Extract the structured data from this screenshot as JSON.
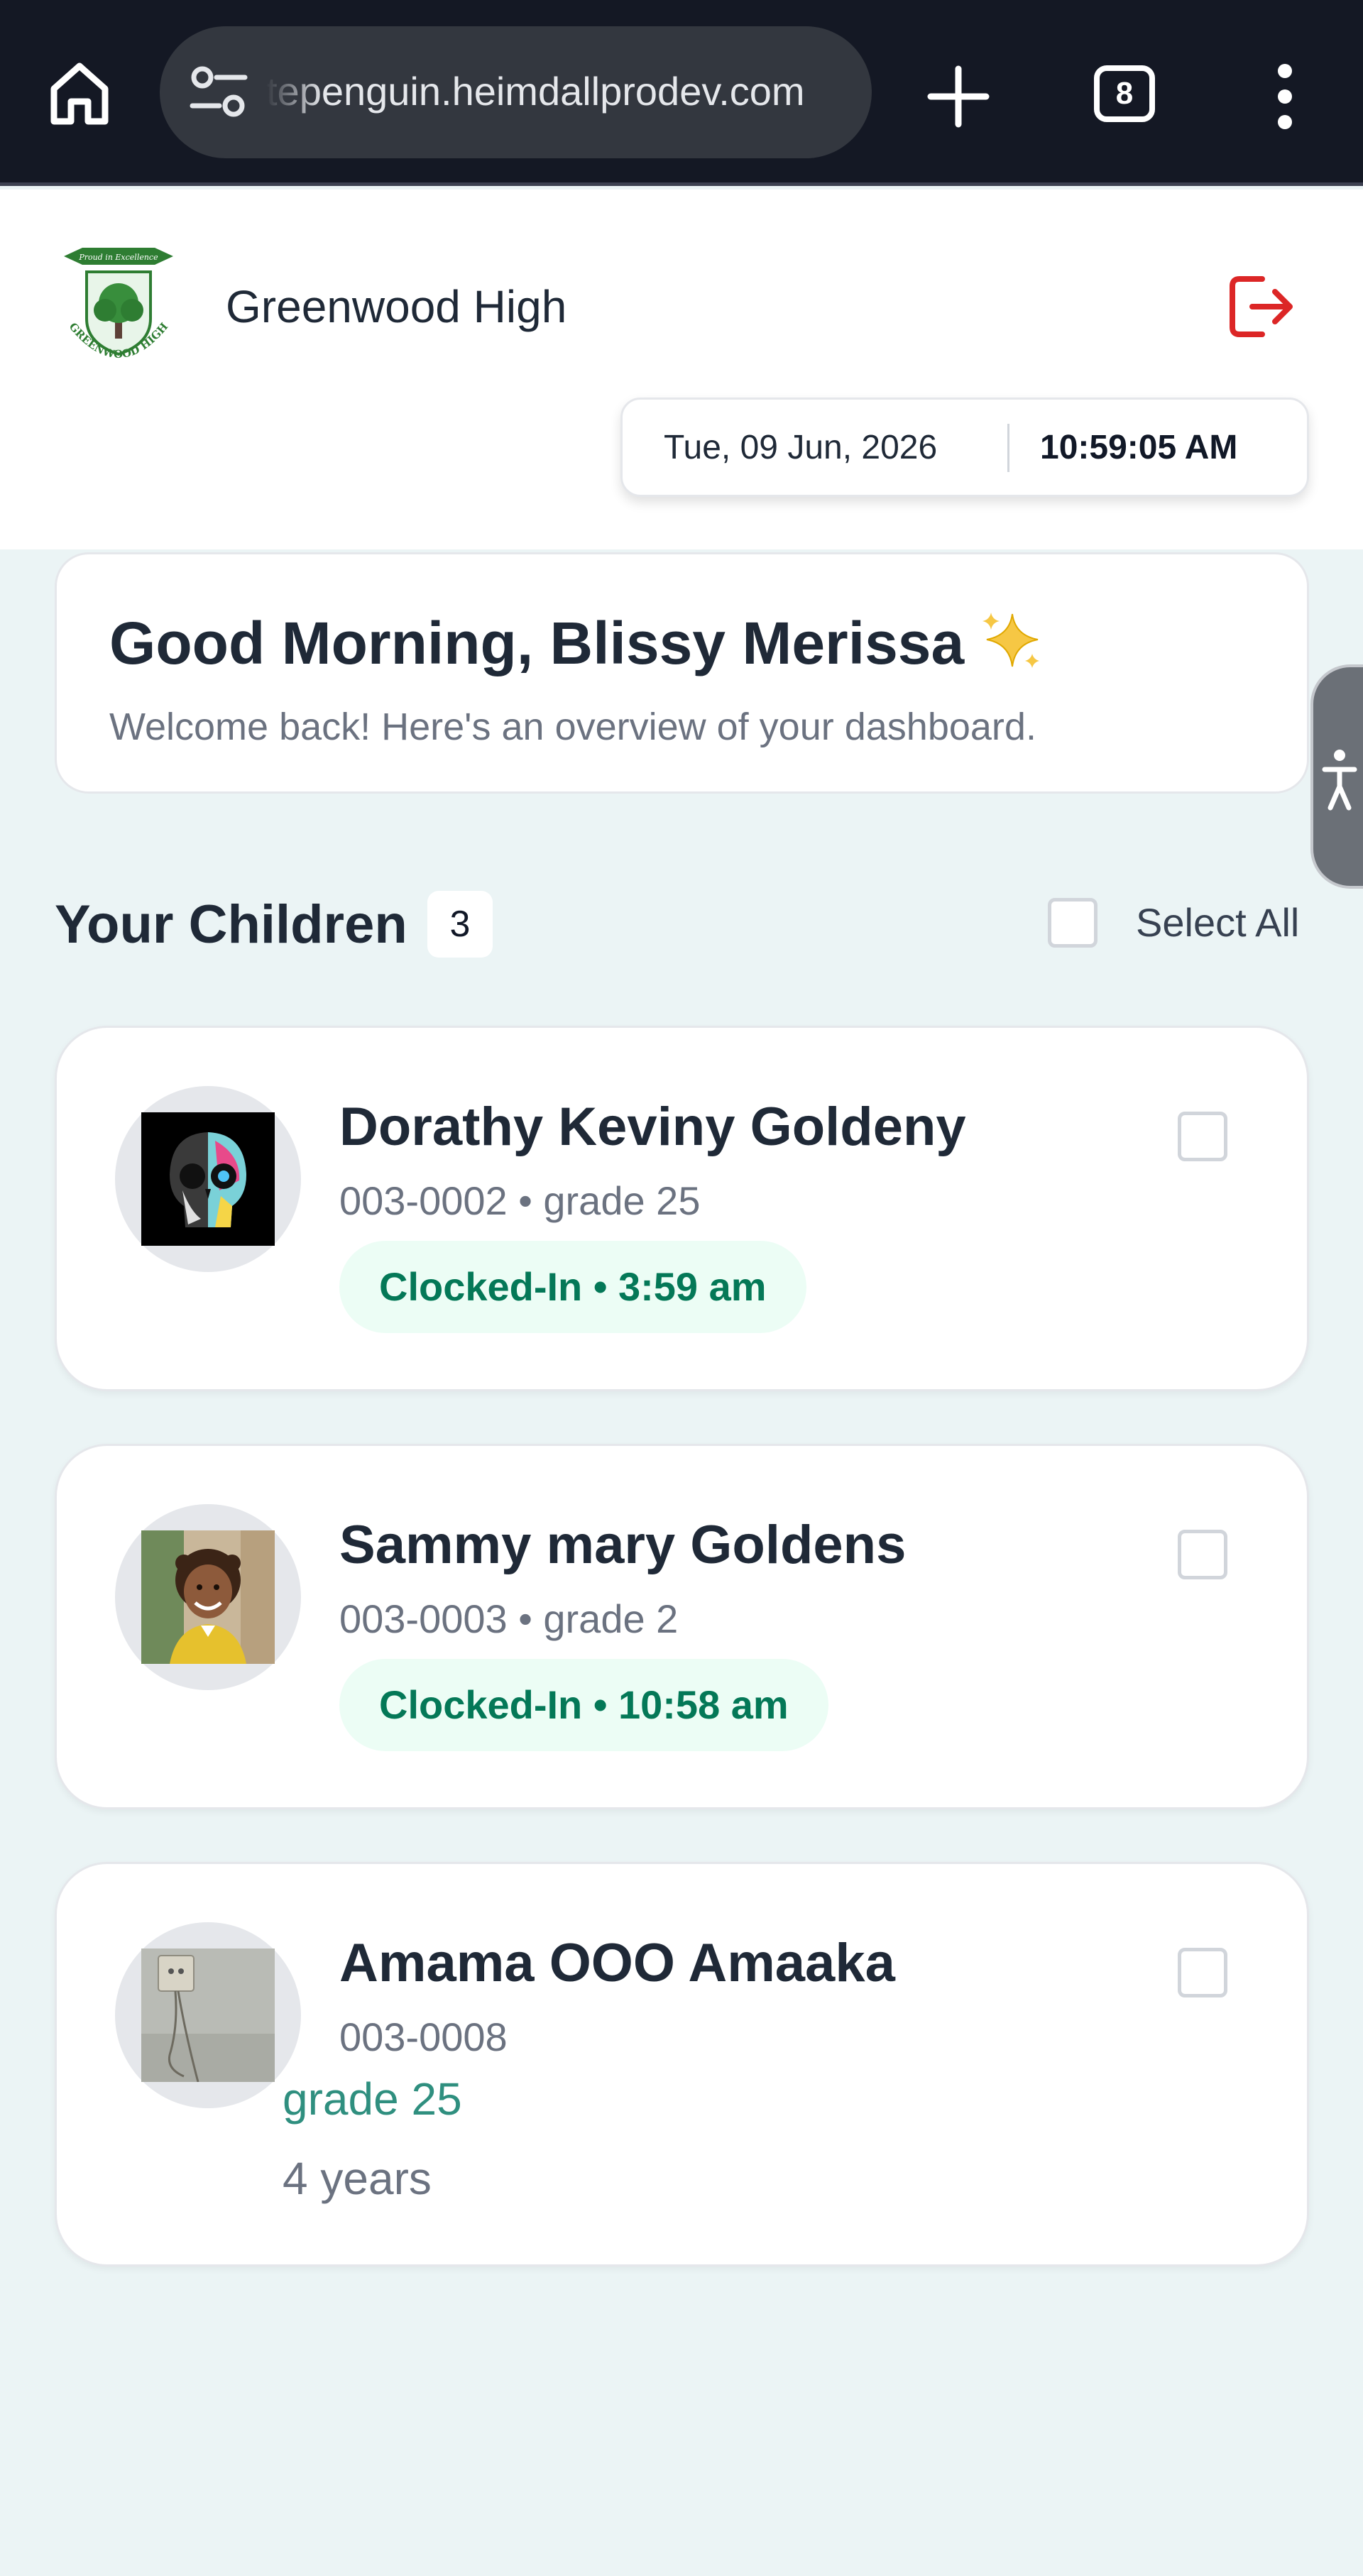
{
  "browser": {
    "url": "tepenguin.heimdallprodev.com",
    "tab_count": "8"
  },
  "header": {
    "school_name": "Greenwood High",
    "logo_motto": "Proud in Excellence",
    "logo_text": "GREENWOOD HIGH",
    "date": "Tue, 09 Jun, 2026",
    "time": "10:59:05 AM"
  },
  "greeting": {
    "title": "Good Morning, Blissy Merissa",
    "subtitle": "Welcome back! Here's an overview of your dashboard."
  },
  "children_section": {
    "title": "Your Children",
    "count": "3",
    "select_all_label": "Select All"
  },
  "children": [
    {
      "name": "Dorathy Keviny Goldeny",
      "meta": "003-0002 • grade 25",
      "status": "Clocked-In • 3:59 am"
    },
    {
      "name": "Sammy mary Goldens",
      "meta": "003-0003 • grade 2",
      "status": "Clocked-In • 10:58 am"
    },
    {
      "name": "Amama OOO Amaaka",
      "id": "003-0008",
      "grade": "grade 25",
      "age": "4 years"
    }
  ],
  "colors": {
    "page_background": "#ebf4f5",
    "status_green": "#047857",
    "logout_red": "#dc2626",
    "grade_teal": "#2f8f7f"
  },
  "icons": [
    "home-icon",
    "tune-icon",
    "plus-icon",
    "more-vert-icon",
    "logout-icon",
    "sparkles-icon",
    "accessibility-icon"
  ]
}
